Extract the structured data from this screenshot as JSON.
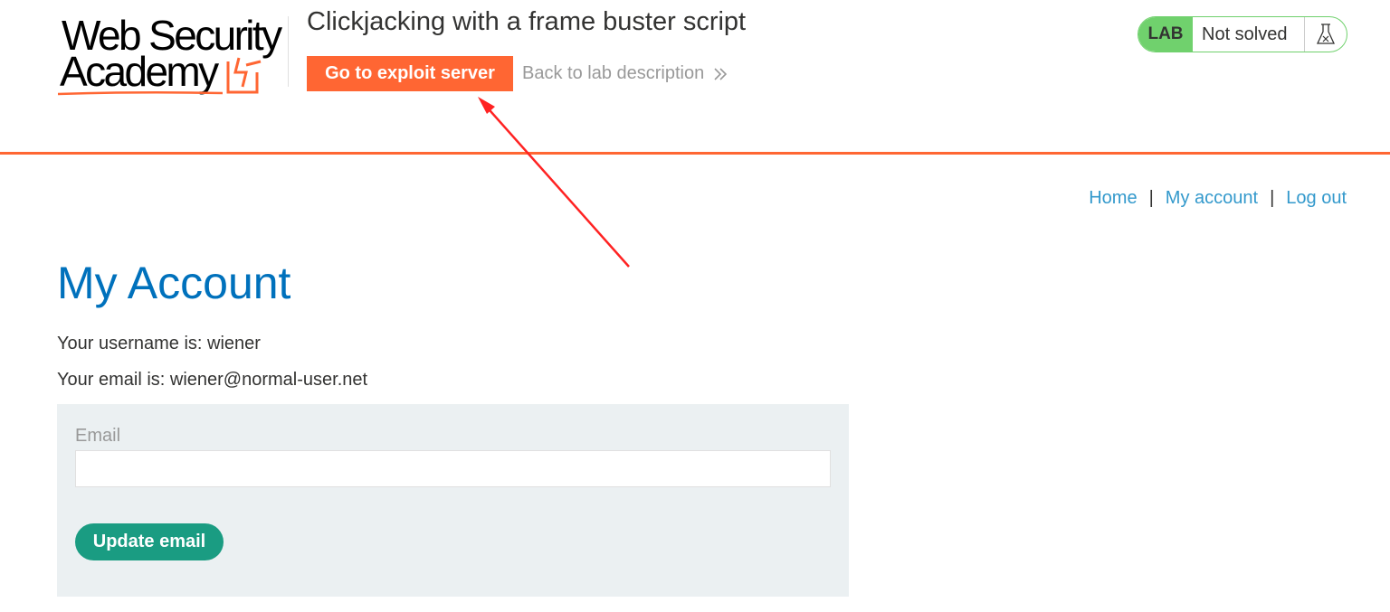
{
  "header": {
    "logo_line1": "Web Security",
    "logo_line2": "Academy",
    "lab_title": "Clickjacking with a frame buster script",
    "exploit_button": "Go to exploit server",
    "back_link": "Back to lab description",
    "status": {
      "badge": "LAB",
      "text": "Not solved",
      "icon": "flask-icon"
    }
  },
  "nav": {
    "home": "Home",
    "my_account": "My account",
    "log_out": "Log out",
    "separator": "|"
  },
  "main": {
    "title": "My Account",
    "username_line": "Your username is: wiener",
    "email_line": "Your email is: wiener@normal-user.net",
    "form": {
      "email_label": "Email",
      "email_value": "",
      "submit_label": "Update email"
    }
  },
  "colors": {
    "accent_orange": "#ff6633",
    "title_blue": "#0071bc",
    "link_blue": "#3399cc",
    "solved_green": "#70d16d",
    "button_teal": "#1a9c82",
    "panel_bg": "#ebf0f2",
    "annotation_red": "#ff2222"
  }
}
